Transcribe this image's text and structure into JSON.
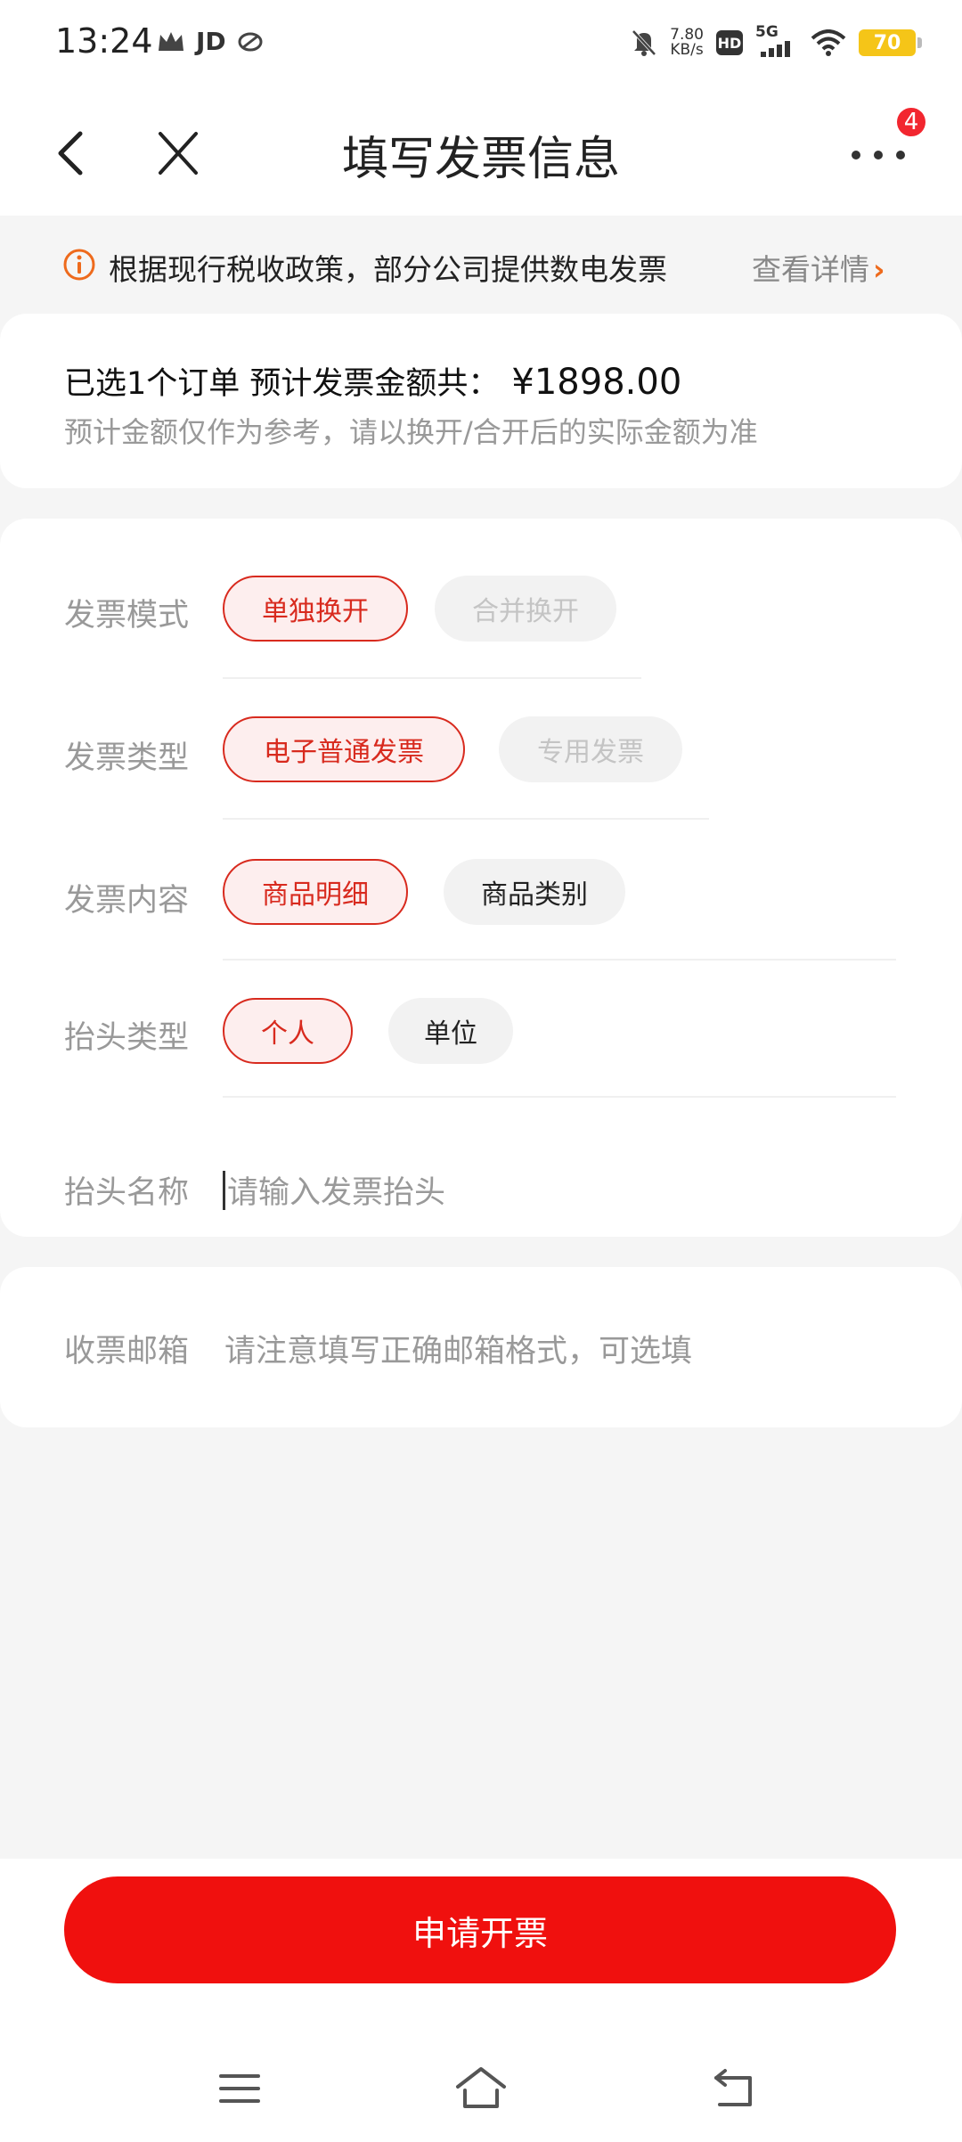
{
  "status_bar": {
    "time": "13:24",
    "app_label": "JD",
    "net_speed_value": "7.80",
    "net_speed_unit": "KB/s",
    "hd": "HD",
    "network": "5G",
    "battery": "70"
  },
  "nav": {
    "title": "填写发票信息",
    "badge_count": "4"
  },
  "notice": {
    "text": "根据现行税收政策，部分公司提供数电发票",
    "detail_label": "查看详情",
    "chevron": "›"
  },
  "order": {
    "summary": "已选1个订单 预计发票金额共：",
    "amount": "¥1898.00",
    "hint": "预计金额仅作为参考，请以换开/合开后的实际金额为准"
  },
  "form": {
    "mode": {
      "label": "发票模式",
      "options": [
        "单独换开",
        "合并换开"
      ]
    },
    "type": {
      "label": "发票类型",
      "options": [
        "电子普通发票",
        "专用发票"
      ]
    },
    "content": {
      "label": "发票内容",
      "options": [
        "商品明细",
        "商品类别"
      ]
    },
    "title_type": {
      "label": "抬头类型",
      "options": [
        "个人",
        "单位"
      ]
    },
    "title_name": {
      "label": "抬头名称",
      "placeholder": "请输入发票抬头"
    }
  },
  "email": {
    "label": "收票邮箱",
    "placeholder": "请注意填写正确邮箱格式，可选填"
  },
  "submit_label": "申请开票",
  "colors": {
    "accent": "#f0100e",
    "selected_border": "#d82a1e",
    "selected_bg": "#fdeeee",
    "notice_icon": "#ee6a1c",
    "badge": "#f2262f"
  },
  "icons": [
    "back-arrow-icon",
    "close-icon",
    "more-dots-icon",
    "info-icon",
    "menu-icon",
    "home-icon",
    "back-icon"
  ]
}
